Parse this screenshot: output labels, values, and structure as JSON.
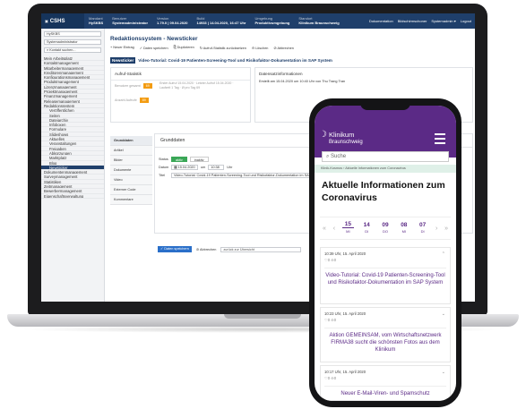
{
  "laptop": {
    "topbar": {
      "logo": "CSHS",
      "cells": [
        {
          "k": "Mandant",
          "v": "HySKBS"
        },
        {
          "k": "Benutzer",
          "v": "Systemadministrator"
        },
        {
          "k": "Version",
          "v": "1.79.0 | 09.04.2020"
        },
        {
          "k": "Build",
          "v": "14933 | 14.04.2020, 16:47 Uhr"
        },
        {
          "k": "Umgebung",
          "v": "Produktivumgebung"
        },
        {
          "k": "Standort",
          "v": "Klinikum Braunschweig"
        }
      ],
      "right": [
        "Dokumentation",
        "Bildschirmschoner",
        "Systemadmin ▾",
        "Logout"
      ]
    },
    "leftnav": {
      "select1": "HySKBS",
      "select2": "Systemadministrator",
      "search": "Kontakt suchen...",
      "items": [
        {
          "label": "Mein Arbeitsplatz",
          "sub": false,
          "active": false
        },
        {
          "label": "Kontaktmanagement",
          "sub": false,
          "active": false
        },
        {
          "label": "Mitarbeitermanagement",
          "sub": false,
          "active": false
        },
        {
          "label": "Kreditorenmanagement",
          "sub": false,
          "active": false
        },
        {
          "label": "Konfigurationsmanagement",
          "sub": false,
          "active": false
        },
        {
          "label": "Produktmanagement",
          "sub": false,
          "active": false
        },
        {
          "label": "Lizenzmanagement",
          "sub": false,
          "active": false
        },
        {
          "label": "Projektmanagement",
          "sub": false,
          "active": false
        },
        {
          "label": "Finanzmanagement",
          "sub": false,
          "active": false
        },
        {
          "label": "Releasemanagement",
          "sub": false,
          "active": false
        },
        {
          "label": "Redaktionssystem",
          "sub": false,
          "active": false
        },
        {
          "label": "Veröffentlichen",
          "sub": true,
          "active": false
        },
        {
          "label": "Seiten",
          "sub": true,
          "active": false
        },
        {
          "label": "Dateiarchiv",
          "sub": true,
          "active": false
        },
        {
          "label": "Infoboxen",
          "sub": true,
          "active": false
        },
        {
          "label": "Formulare",
          "sub": true,
          "active": false
        },
        {
          "label": "Slideshows",
          "sub": true,
          "active": false
        },
        {
          "label": "Aktuelles",
          "sub": true,
          "active": false
        },
        {
          "label": "Veranstaltungen",
          "sub": true,
          "active": false
        },
        {
          "label": "Freigaben",
          "sub": true,
          "active": false
        },
        {
          "label": "Abkürzungen",
          "sub": true,
          "active": false
        },
        {
          "label": "Marktplatz",
          "sub": true,
          "active": false
        },
        {
          "label": "Blog",
          "sub": true,
          "active": false
        },
        {
          "label": "Newsticker",
          "sub": true,
          "active": true
        },
        {
          "label": "Dokumentenmanagement",
          "sub": false,
          "active": false
        },
        {
          "label": "Surveymanagement",
          "sub": false,
          "active": false
        },
        {
          "label": "Statistiken",
          "sub": false,
          "active": false
        },
        {
          "label": "Zeitmanagement",
          "sub": false,
          "active": false
        },
        {
          "label": "Bewerbermanagement",
          "sub": false,
          "active": false
        },
        {
          "label": "Eigenschaftsverwaltung",
          "sub": false,
          "active": false
        }
      ]
    },
    "main": {
      "title": "Redaktionssystem - Newsticker",
      "toolbar": [
        "+ Neuer Eintrag",
        "✓ Daten speichern",
        "⎘ Duplizieren",
        "↻ Aufruf-Statistik zurücksetzen",
        "⊖ Löschen",
        "⊘ Abbrechen"
      ],
      "news_tag": "Newsticker",
      "news_title": "Video-Tutorial: Covid-19 Patienten-Screening-Tool und Risikofaktor-Dokumentation im SAP System",
      "stats": {
        "heading": "Aufruf-Statistik",
        "r1_label": "Benutzer gesamt",
        "r1_value": "69",
        "r1_detail": "Erster Aufruf 15.04.2020 · Letzter Aufruf 15.04.2020 · Laufzeit 1 Tag · Ø pro Tag 69",
        "r2_label": "Anzahl Aufrufe",
        "r2_value": "89"
      },
      "info": {
        "heading": "Datensatzinformationen",
        "text": "Erstellt am 15.04.2020 um 10:40 Uhr von Thu Trang Tran"
      },
      "tabs": [
        "Grunddaten",
        "Artikel",
        "Bilder",
        "Dokumente",
        "Video",
        "Externer Code",
        "Kommentare"
      ],
      "form": {
        "heading": "Grunddaten",
        "status_label": "Status",
        "status_on": "aktiv",
        "status_off": "inaktiv",
        "date_label": "Datum",
        "date_value": "15.04.2020",
        "time_sep": "um",
        "time_value": "10:38",
        "time_unit": "Uhr",
        "title_label": "Titel",
        "title_value": "Video-Tutorial: Covid-19 Patienten-Screening-Tool und Risikofaktor-Dokumentation im SAP System"
      },
      "save": "Daten speichern",
      "cancel": "Abbrechen",
      "back": "zurück zur Übersicht"
    }
  },
  "phone": {
    "brand1": "Klinikum",
    "brand2": "Braunschweig",
    "search": "Suche",
    "breadcrumb": "Klinik-Kosmos › Aktuelle Informationen zum Coronavirus",
    "title": "Aktuelle Informationen zum Coronavirus",
    "dates": [
      {
        "n": "15",
        "d": "MI"
      },
      {
        "n": "14",
        "d": "DI"
      },
      {
        "n": "09",
        "d": "DO"
      },
      {
        "n": "08",
        "d": "MI"
      },
      {
        "n": "07",
        "d": "DI"
      }
    ],
    "cards": [
      {
        "meta": "10:39 Uhr, 15. April 2020",
        "icons": "♡0 ⊖0",
        "title": "Video-Tutorial: Covid-19 Patienten-Screening-Tool und Risikofaktor-Dokumentation im SAP System"
      },
      {
        "meta": "10:23 Uhr, 15. April 2020",
        "icons": "♡0 ⊖0",
        "title": "Aktion GEMEINSAM, vom Wirtschaftsnetzwerk FIRMA38 sucht die schönsten Fotos aus dem Klinikum"
      },
      {
        "meta": "10:17 Uhr, 15. April 2020",
        "icons": "♡0 ⊖0",
        "title": "Neuer E-Mail-Viren- und Spamschutz"
      }
    ]
  }
}
